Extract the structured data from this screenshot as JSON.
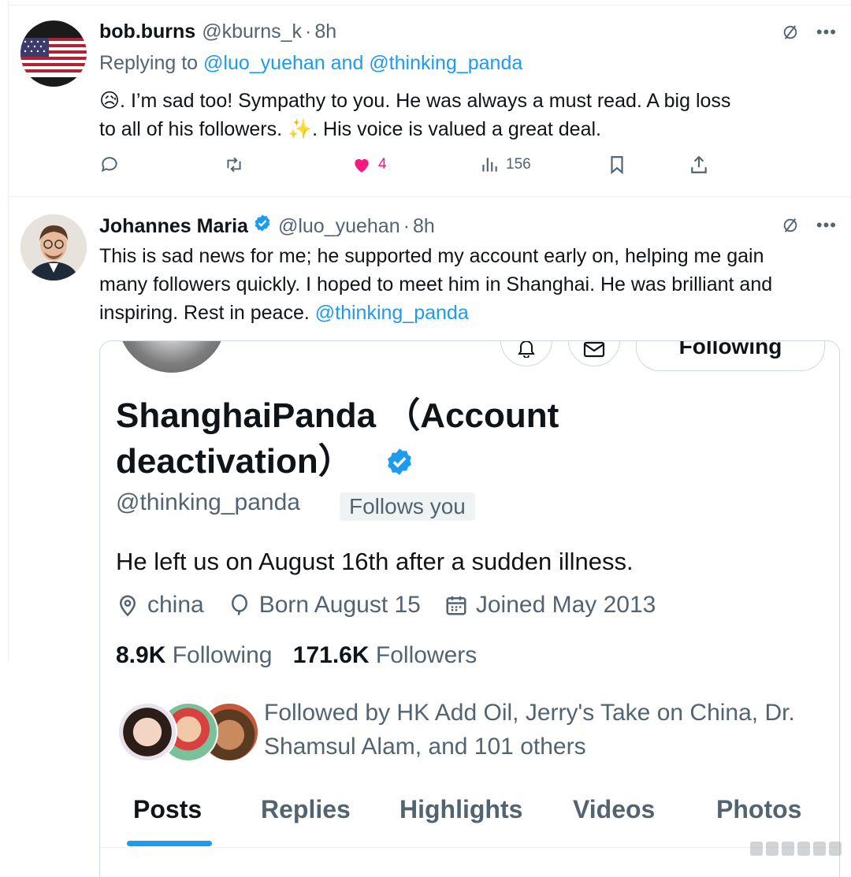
{
  "tweet1": {
    "name": "bob.burns",
    "handle": "@kburns_k",
    "dot": "·",
    "time": "8h",
    "replying_prefix": "Replying to",
    "replying_targets": "@luo_yuehan and @thinking_panda",
    "text_line1": "😥. I’m sad too!   Sympathy to you.   He was always a must read.   A big loss",
    "text_line2": "to all of his followers.   ✨. His voice is valued a great deal.",
    "likes": "4",
    "views": "156",
    "like_color": "#f91880"
  },
  "tweet2": {
    "name": "Johannes Maria",
    "handle": "@luo_yuehan",
    "dot": "·",
    "time": "8h",
    "text_line1": "This is sad news for me; he supported my account early on, helping me gain",
    "text_line2": "many followers quickly. I hoped to meet him in Shanghai. He was brilliant and",
    "text_line3_prefix": "inspiring. Rest in peace.",
    "mention": "@thinking_panda"
  },
  "profile_card": {
    "following_label": "Following",
    "name_line1": "ShanghaiPanda （Account",
    "name_line2": "deactivation）",
    "handle": "@thinking_panda",
    "follows_you": "Follows you",
    "bio": "He left us on August 16th after a sudden illness.",
    "location": "china",
    "birthday": "Born August 15",
    "joined": "Joined May 2013",
    "following_count": "8.9K",
    "following_label_short": "Following",
    "followers_count": "171.6K",
    "followers_label": "Followers",
    "followed_by_line1": "Followed by HK Add Oil, Jerry's Take on China, Dr.",
    "followed_by_line2": "Shamsul Alam, and 101 others",
    "tabs": [
      "Posts",
      "Replies",
      "Highlights",
      "Videos",
      "Photos"
    ]
  },
  "colors": {
    "accent": "#1d9bf0",
    "muted": "#536471",
    "text": "#0f1419"
  }
}
